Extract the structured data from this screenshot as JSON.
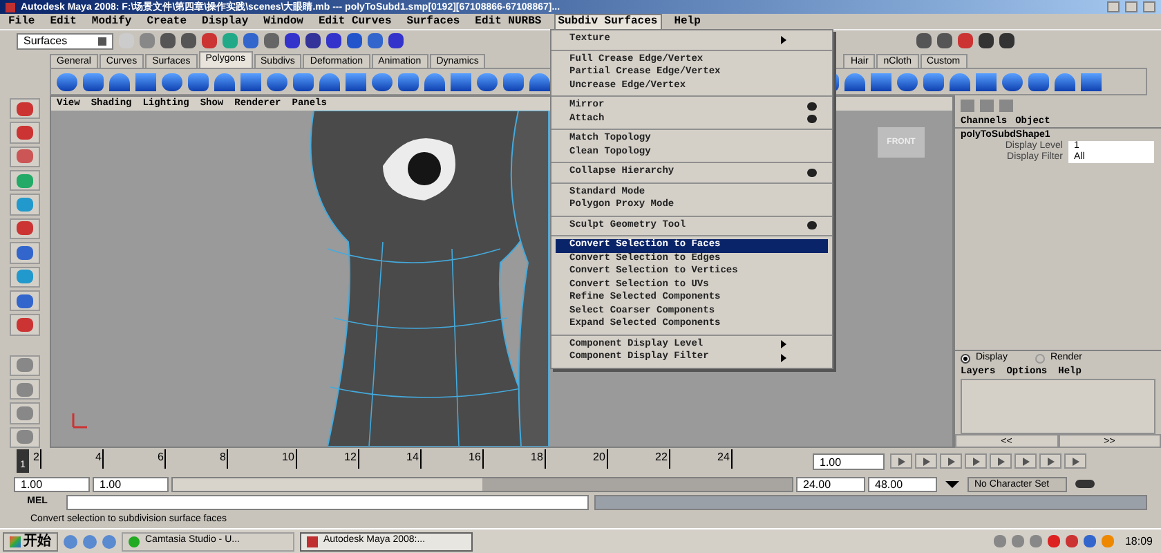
{
  "window": {
    "title": "Autodesk Maya 2008: F:\\场景文件\\第四章\\操作实践\\scenes\\大眼睛.mb  ---  polyToSubd1.smp[0192][67108866-67108867]..."
  },
  "menubar": [
    {
      "label": "File",
      "selected": false
    },
    {
      "label": "Edit",
      "selected": false
    },
    {
      "label": "Modify",
      "selected": false
    },
    {
      "label": "Create",
      "selected": false
    },
    {
      "label": "Display",
      "selected": false
    },
    {
      "label": "Window",
      "selected": false
    },
    {
      "label": "Edit Curves",
      "selected": false
    },
    {
      "label": "Surfaces",
      "selected": false
    },
    {
      "label": "Edit NURBS",
      "selected": false
    },
    {
      "label": "Subdiv Surfaces",
      "selected": true
    },
    {
      "label": "Help",
      "selected": false
    }
  ],
  "status_line": {
    "menu_set": "Surfaces"
  },
  "shelf_tabs": [
    {
      "label": "General",
      "selected": false
    },
    {
      "label": "Curves",
      "selected": false
    },
    {
      "label": "Surfaces",
      "selected": false
    },
    {
      "label": "Polygons",
      "selected": true
    },
    {
      "label": "Subdivs",
      "selected": false
    },
    {
      "label": "Deformation",
      "selected": false
    },
    {
      "label": "Animation",
      "selected": false
    },
    {
      "label": "Dynamics",
      "selected": false
    },
    {
      "label": "Hair",
      "selected": false
    },
    {
      "label": "nCloth",
      "selected": false
    },
    {
      "label": "Custom",
      "selected": false
    }
  ],
  "panel_menu": [
    "View",
    "Shading",
    "Lighting",
    "Show",
    "Renderer",
    "Panels"
  ],
  "view_cube": {
    "label": "FRONT"
  },
  "dropdown": [
    [
      {
        "label": "Texture",
        "kind": "submenu",
        "selected": false
      }
    ],
    [
      {
        "label": "Full Crease Edge/Vertex",
        "kind": "item",
        "selected": false
      },
      {
        "label": "Partial Crease Edge/Vertex",
        "kind": "item",
        "selected": false
      },
      {
        "label": "Uncrease Edge/Vertex",
        "kind": "item",
        "selected": false
      }
    ],
    [
      {
        "label": "Mirror",
        "kind": "option",
        "selected": false
      },
      {
        "label": "Attach",
        "kind": "option",
        "selected": false
      }
    ],
    [
      {
        "label": "Match Topology",
        "kind": "item",
        "selected": false
      },
      {
        "label": "Clean Topology",
        "kind": "item",
        "selected": false
      }
    ],
    [
      {
        "label": "Collapse Hierarchy",
        "kind": "option",
        "selected": false
      }
    ],
    [
      {
        "label": "Standard Mode",
        "kind": "item",
        "selected": false
      },
      {
        "label": "Polygon Proxy Mode",
        "kind": "item",
        "selected": false
      }
    ],
    [
      {
        "label": "Sculpt Geometry Tool",
        "kind": "option",
        "selected": false
      }
    ],
    [
      {
        "label": "Convert Selection to Faces",
        "kind": "item",
        "selected": true
      },
      {
        "label": "Convert Selection to Edges",
        "kind": "item",
        "selected": false
      },
      {
        "label": "Convert Selection to Vertices",
        "kind": "item",
        "selected": false
      },
      {
        "label": "Convert Selection to UVs",
        "kind": "item",
        "selected": false
      },
      {
        "label": "Refine Selected Components",
        "kind": "item",
        "selected": false
      },
      {
        "label": "Select Coarser Components",
        "kind": "item",
        "selected": false
      },
      {
        "label": "Expand Selected Components",
        "kind": "item",
        "selected": false
      }
    ],
    [
      {
        "label": "Component Display Level",
        "kind": "submenu",
        "selected": false
      },
      {
        "label": "Component Display Filter",
        "kind": "submenu",
        "selected": false
      }
    ]
  ],
  "channel_box": {
    "tabs": [
      "Channels",
      "Object"
    ],
    "node": "polyToSubdShape1",
    "attributes": [
      {
        "name": "Display Level",
        "value": "1"
      },
      {
        "name": "Display Filter",
        "value": "All"
      }
    ]
  },
  "layer_editor": {
    "radios": [
      {
        "label": "Display",
        "selected": true
      },
      {
        "label": "Render",
        "selected": false
      }
    ],
    "menu": [
      "Layers",
      "Options",
      "Help"
    ]
  },
  "page_buttons": [
    "<<",
    ">>"
  ],
  "timeline": {
    "current": "1",
    "level": 0,
    "ticks": [
      "2",
      "4",
      "6",
      "8",
      "10",
      "12",
      "14",
      "16",
      "18",
      "20",
      "22",
      "24"
    ],
    "current_frame": "1.00"
  },
  "range": {
    "level": 0.5,
    "start": "1.00",
    "playback_start": "1.00",
    "playback_end": "24.00",
    "end": "48.00",
    "character_set": "No Character Set"
  },
  "command_line": {
    "label": "MEL"
  },
  "help_line": "Convert selection to subdivision surface faces",
  "taskbar": {
    "start": "开始",
    "tasks": [
      {
        "label": "Camtasia Studio - U...",
        "selected": false
      },
      {
        "label": "Autodesk Maya 2008:...",
        "selected": true
      }
    ],
    "clock": "18:09"
  }
}
